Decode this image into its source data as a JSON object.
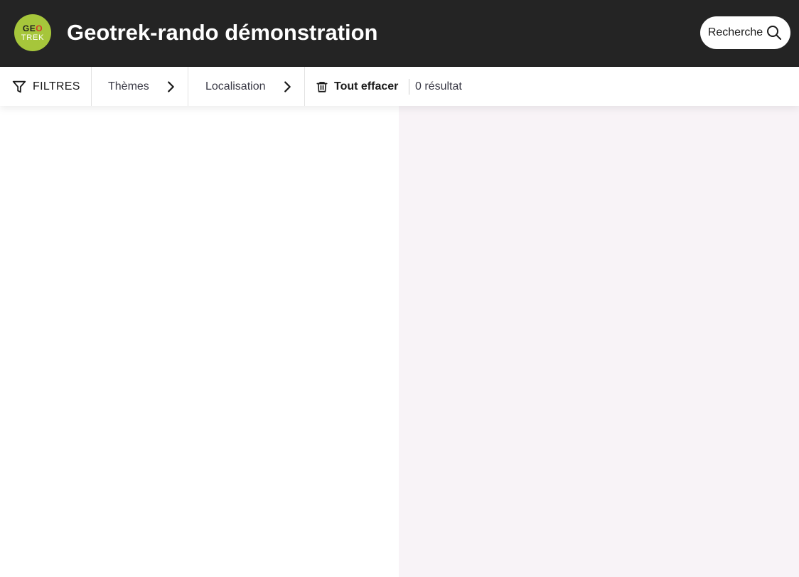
{
  "header": {
    "logo": {
      "line1_a": "GE",
      "line1_b": "O",
      "line2": "TREK"
    },
    "title": "Geotrek-rando démonstration",
    "search_label": "Recherche"
  },
  "filterbar": {
    "filters_label": "FILTRES",
    "themes_label": "Thèmes",
    "localisation_label": "Localisation",
    "clear_label": "Tout effacer",
    "results_label": "0 résultat"
  },
  "colors": {
    "header_bg": "#242424",
    "logo_bg": "#a6c63b",
    "map_bg": "#f8f3f7"
  },
  "icons": {
    "filter": "filter-funnel-icon",
    "chevron": "chevron-right-icon",
    "trash": "trash-icon",
    "search": "search-icon"
  }
}
